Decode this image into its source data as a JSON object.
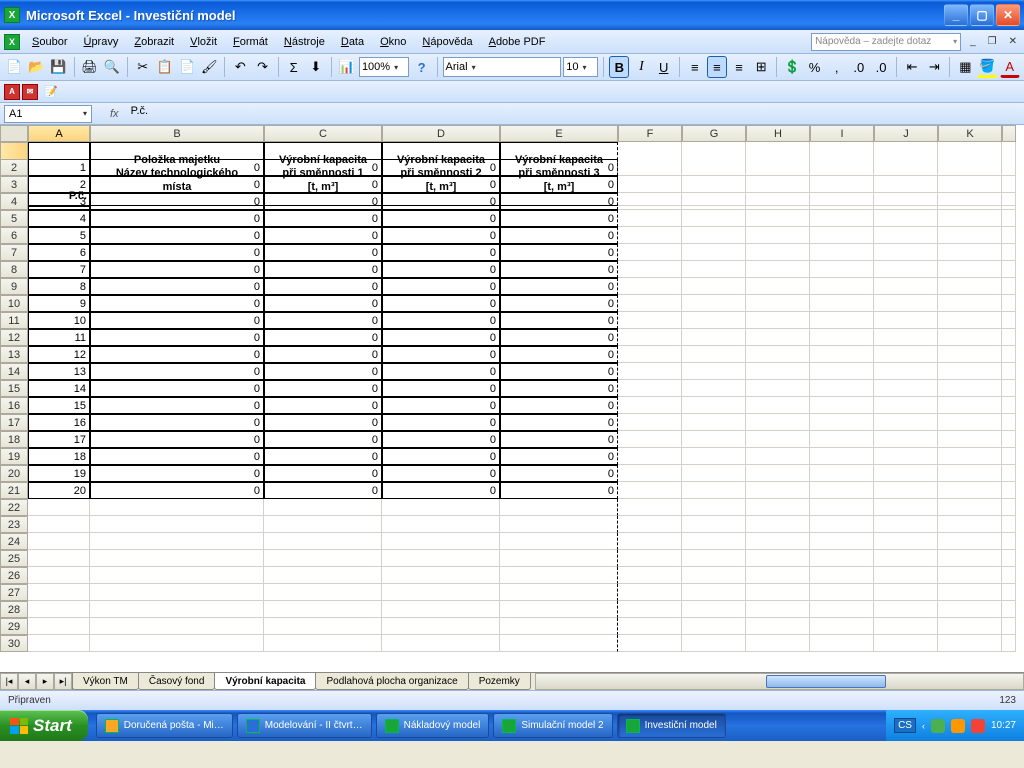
{
  "titlebar": {
    "app": "Microsoft Excel",
    "doc": "Investiční model"
  },
  "menu": [
    "Soubor",
    "Úpravy",
    "Zobrazit",
    "Vložit",
    "Formát",
    "Nástroje",
    "Data",
    "Okno",
    "Nápověda",
    "Adobe PDF"
  ],
  "helpbox_placeholder": "Nápověda – zadejte dotaz",
  "toolbar1": {
    "zoom": "100%",
    "font": "Arial",
    "size": "10"
  },
  "namebox": "A1",
  "formula": "P.č.",
  "columns": [
    "A",
    "B",
    "C",
    "D",
    "E",
    "F",
    "G",
    "H",
    "I",
    "J",
    "K"
  ],
  "header_row": {
    "A": "P.č.",
    "B": "Položka majetku\nNázev technologického\nmísta",
    "C": "Výrobní kapacita\npři směnnosti 1\n[t, m³]",
    "D": "Výrobní kapacita\npři směnnosti 2\n[t, m³]",
    "E": "Výrobní kapacita\npři směnnosti 3\n[t, m³]"
  },
  "data_rows": [
    {
      "row": 2,
      "A": "1",
      "B": "0",
      "C": "0",
      "D": "0",
      "E": "0"
    },
    {
      "row": 3,
      "A": "2",
      "B": "0",
      "C": "0",
      "D": "0",
      "E": "0"
    },
    {
      "row": 4,
      "A": "3",
      "B": "0",
      "C": "0",
      "D": "0",
      "E": "0"
    },
    {
      "row": 5,
      "A": "4",
      "B": "0",
      "C": "0",
      "D": "0",
      "E": "0"
    },
    {
      "row": 6,
      "A": "5",
      "B": "0",
      "C": "0",
      "D": "0",
      "E": "0"
    },
    {
      "row": 7,
      "A": "6",
      "B": "0",
      "C": "0",
      "D": "0",
      "E": "0"
    },
    {
      "row": 8,
      "A": "7",
      "B": "0",
      "C": "0",
      "D": "0",
      "E": "0"
    },
    {
      "row": 9,
      "A": "8",
      "B": "0",
      "C": "0",
      "D": "0",
      "E": "0"
    },
    {
      "row": 10,
      "A": "9",
      "B": "0",
      "C": "0",
      "D": "0",
      "E": "0"
    },
    {
      "row": 11,
      "A": "10",
      "B": "0",
      "C": "0",
      "D": "0",
      "E": "0"
    },
    {
      "row": 12,
      "A": "11",
      "B": "0",
      "C": "0",
      "D": "0",
      "E": "0"
    },
    {
      "row": 13,
      "A": "12",
      "B": "0",
      "C": "0",
      "D": "0",
      "E": "0"
    },
    {
      "row": 14,
      "A": "13",
      "B": "0",
      "C": "0",
      "D": "0",
      "E": "0"
    },
    {
      "row": 15,
      "A": "14",
      "B": "0",
      "C": "0",
      "D": "0",
      "E": "0"
    },
    {
      "row": 16,
      "A": "15",
      "B": "0",
      "C": "0",
      "D": "0",
      "E": "0"
    },
    {
      "row": 17,
      "A": "16",
      "B": "0",
      "C": "0",
      "D": "0",
      "E": "0"
    },
    {
      "row": 18,
      "A": "17",
      "B": "0",
      "C": "0",
      "D": "0",
      "E": "0"
    },
    {
      "row": 19,
      "A": "18",
      "B": "0",
      "C": "0",
      "D": "0",
      "E": "0"
    },
    {
      "row": 20,
      "A": "19",
      "B": "0",
      "C": "0",
      "D": "0",
      "E": "0"
    },
    {
      "row": 21,
      "A": "20",
      "B": "0",
      "C": "0",
      "D": "0",
      "E": "0"
    }
  ],
  "empty_rows": [
    22,
    23,
    24,
    25,
    26,
    27,
    28,
    29,
    30
  ],
  "sheet_tabs": [
    "Výkon TM",
    "Časový fond",
    "Výrobní kapacita",
    "Podlahová plocha organizace",
    "Pozemky"
  ],
  "active_tab": 2,
  "status": {
    "left": "Připraven",
    "right": "123"
  },
  "taskbar": {
    "start": "Start",
    "items": [
      {
        "label": "Doručená pošta - Mi…",
        "icon": "#f9a825"
      },
      {
        "label": "Modelování - II čtvrt…",
        "icon": "#2a6fd6"
      },
      {
        "label": "Nákladový model",
        "icon": "#17a637"
      },
      {
        "label": "Simulační model 2",
        "icon": "#17a637"
      },
      {
        "label": "Investiční model",
        "icon": "#17a637",
        "active": true
      }
    ],
    "lang": "CS",
    "clock": "10:27"
  }
}
